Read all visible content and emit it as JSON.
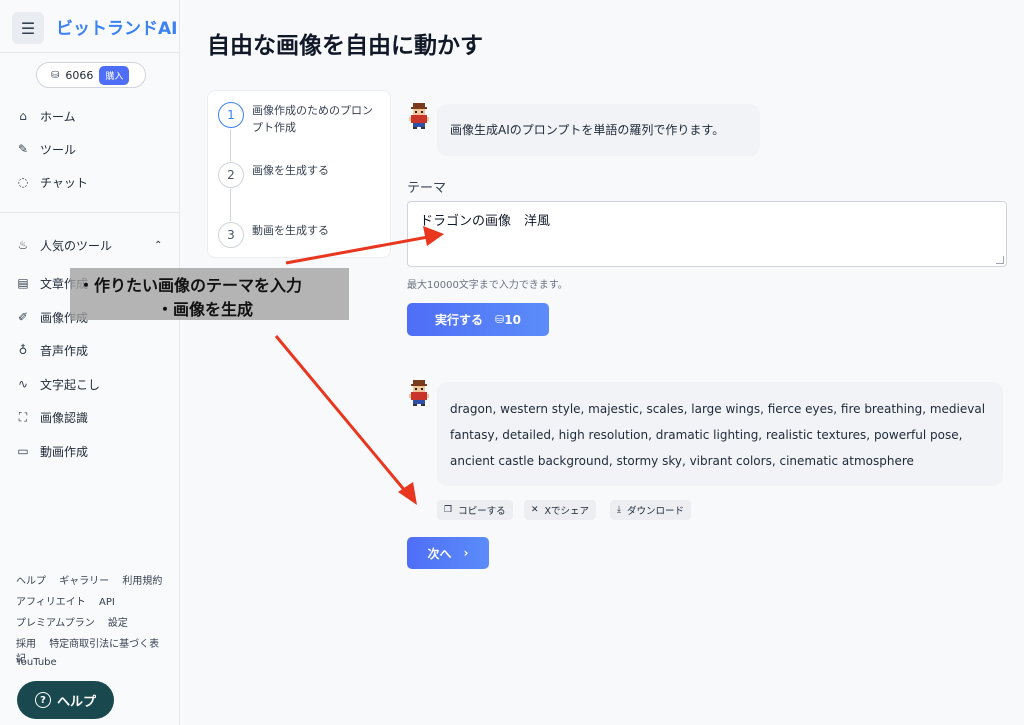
{
  "sidebar": {
    "brand": "ビットランドAI",
    "credits": "6066",
    "buy_label": "購入",
    "nav": [
      {
        "label": "ホーム"
      },
      {
        "label": "ツール"
      },
      {
        "label": "チャット"
      }
    ],
    "popular_label": "人気のツール",
    "tools": [
      {
        "label": "文章作成"
      },
      {
        "label": "画像作成"
      },
      {
        "label": "音声作成"
      },
      {
        "label": "文字起こし"
      },
      {
        "label": "画像認識"
      },
      {
        "label": "動画作成"
      }
    ],
    "footer": {
      "row1": [
        "ヘルプ",
        "ギャラリー",
        "利用規約"
      ],
      "row2": [
        "アフィリエイト",
        "API"
      ],
      "row3": [
        "プレミアムプラン",
        "設定"
      ],
      "row4": [
        "採用",
        "特定商取引法に基づく表記"
      ],
      "row5": [
        "YouTube"
      ]
    },
    "help_label": "ヘルプ"
  },
  "main": {
    "title": "自由な画像を自由に動かす",
    "steps": [
      {
        "num": "1",
        "label": "画像作成のためのプロンプト作成"
      },
      {
        "num": "2",
        "label": "画像を生成する"
      },
      {
        "num": "3",
        "label": "動画を生成する"
      }
    ],
    "intro_message": "画像生成AIのプロンプトを単語の羅列で作ります。",
    "theme_label": "テーマ",
    "theme_value": "ドラゴンの画像　洋風",
    "hint": "最大10000文字まで入力できます。",
    "run_label": "実行する",
    "run_cost": "10",
    "result_text": "dragon, western style, majestic, scales, large wings, fierce eyes, fire breathing, medieval fantasy, detailed, high resolution, dramatic lighting, realistic textures, powerful pose, ancient castle background, stormy sky, vibrant colors, cinematic atmosphere",
    "actions": {
      "copy": "コピーする",
      "share": "Xでシェア",
      "download": "ダウンロード"
    },
    "next_label": "次へ"
  },
  "annotation": {
    "line1": "・作りたい画像のテーマを入力",
    "line2": "・画像を生成"
  },
  "colors": {
    "brand": "#3b82f6",
    "button": "#4f6ef7",
    "help_button": "#19494f",
    "arrow": "#e8361f"
  }
}
